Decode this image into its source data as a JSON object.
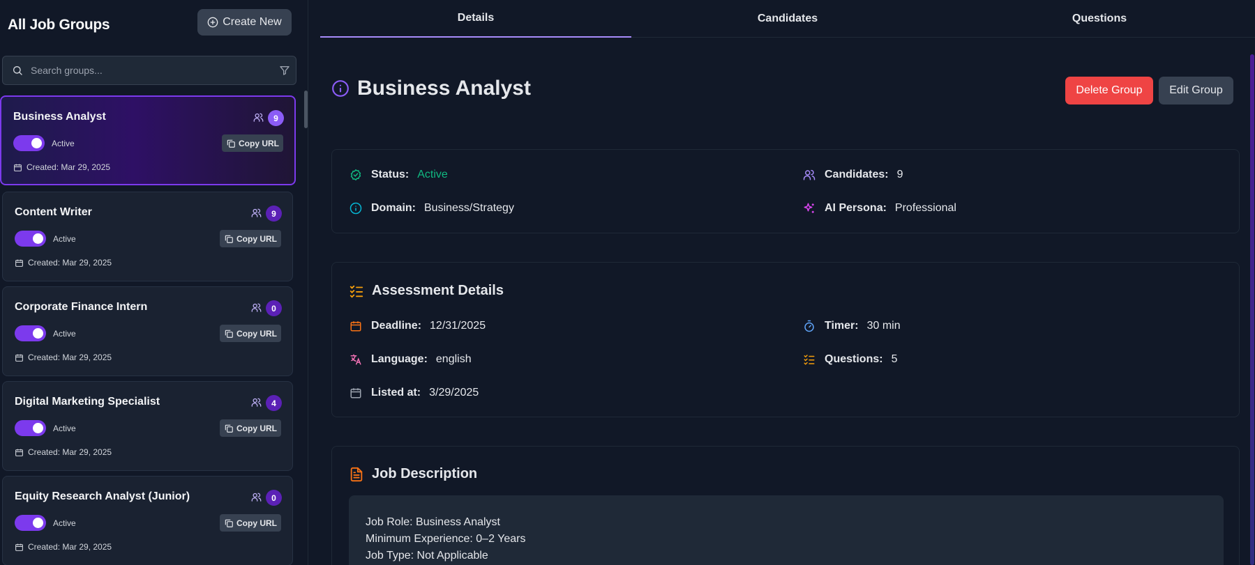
{
  "sidebar": {
    "title": "All Job Groups",
    "create_label": "Create New",
    "search_placeholder": "Search groups...",
    "groups": [
      {
        "name": "Business Analyst",
        "count": "9",
        "status": "Active",
        "copy_label": "Copy URL",
        "created": "Created: Mar 29, 2025"
      },
      {
        "name": "Content Writer",
        "count": "9",
        "status": "Active",
        "copy_label": "Copy URL",
        "created": "Created: Mar 29, 2025"
      },
      {
        "name": "Corporate Finance Intern",
        "count": "0",
        "status": "Active",
        "copy_label": "Copy URL",
        "created": "Created: Mar 29, 2025"
      },
      {
        "name": "Digital Marketing Specialist",
        "count": "4",
        "status": "Active",
        "copy_label": "Copy URL",
        "created": "Created: Mar 29, 2025"
      },
      {
        "name": "Equity Research Analyst (Junior)",
        "count": "0",
        "status": "Active",
        "copy_label": "Copy URL",
        "created": "Created: Mar 29, 2025"
      }
    ]
  },
  "tabs": [
    "Details",
    "Candidates",
    "Questions"
  ],
  "detail": {
    "title": "Business Analyst",
    "delete_label": "Delete Group",
    "edit_label": "Edit Group",
    "overview": {
      "status_label": "Status:",
      "status_value": "Active",
      "candidates_label": "Candidates:",
      "candidates_value": "9",
      "domain_label": "Domain:",
      "domain_value": "Business/Strategy",
      "persona_label": "AI Persona:",
      "persona_value": "Professional"
    },
    "assessment": {
      "heading": "Assessment Details",
      "deadline_label": "Deadline:",
      "deadline_value": "12/31/2025",
      "timer_label": "Timer:",
      "timer_value": "30 min",
      "language_label": "Language:",
      "language_value": "english",
      "questions_label": "Questions:",
      "questions_value": "5",
      "listed_label": "Listed at:",
      "listed_value": "3/29/2025"
    },
    "job_description": {
      "heading": "Job Description",
      "lines": [
        "Job Role: Business Analyst",
        "Minimum Experience: 0–2 Years",
        "Job Type: Not Applicable"
      ]
    }
  },
  "colors": {
    "accent": "#7c3aed",
    "danger": "#ef4444",
    "success": "#10b981",
    "background": "#111827"
  },
  "icons": [
    "plus-circle-icon",
    "search-icon",
    "filter-icon",
    "users-icon",
    "copy-icon",
    "calendar-icon",
    "info-icon",
    "check-circle-icon",
    "sparkles-icon",
    "list-checks-icon",
    "timer-icon",
    "languages-icon",
    "file-text-icon"
  ]
}
